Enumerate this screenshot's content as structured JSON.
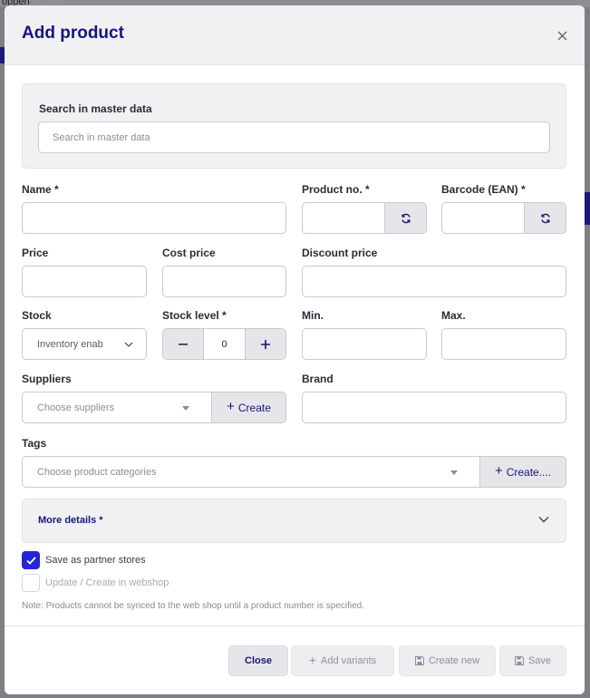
{
  "background": {
    "app_text": "oppen",
    "app_id": "ID: 3182"
  },
  "modal": {
    "title": "Add product",
    "close_icon": "close-icon"
  },
  "master_search": {
    "label": "Search in master data",
    "placeholder": "Search in master data",
    "value": ""
  },
  "fields": {
    "name": {
      "label": "Name *",
      "value": ""
    },
    "product_no": {
      "label": "Product no. *",
      "value": ""
    },
    "barcode": {
      "label": "Barcode (EAN) *",
      "value": ""
    },
    "price": {
      "label": "Price",
      "value": ""
    },
    "cost_price": {
      "label": "Cost price",
      "value": ""
    },
    "discount_price": {
      "label": "Discount price",
      "value": ""
    },
    "stock": {
      "label": "Stock",
      "selected": "Inventory enab"
    },
    "stock_level": {
      "label": "Stock level *",
      "value": "0"
    },
    "min": {
      "label": "Min.",
      "value": ""
    },
    "max": {
      "label": "Max.",
      "value": ""
    },
    "suppliers": {
      "label": "Suppliers",
      "placeholder": "Choose suppliers",
      "create_label": "Create"
    },
    "brand": {
      "label": "Brand",
      "value": ""
    },
    "tags": {
      "label": "Tags",
      "placeholder": "Choose product categories",
      "create_label": "Create...."
    }
  },
  "more_details": {
    "label": "More details *"
  },
  "options": {
    "partner_stores": {
      "label": "Save as partner stores",
      "checked": true
    },
    "webshop": {
      "label": "Update / Create in webshop",
      "checked": false
    }
  },
  "note": "Note: Products cannot be synced to the web shop until a product number is specified.",
  "footer": {
    "close": "Close",
    "add_variants": "Add variants",
    "create_new": "Create new",
    "save": "Save"
  },
  "colors": {
    "accent": "#16167a",
    "checkbox": "#2525d6",
    "panel": "#f1f1f4"
  }
}
